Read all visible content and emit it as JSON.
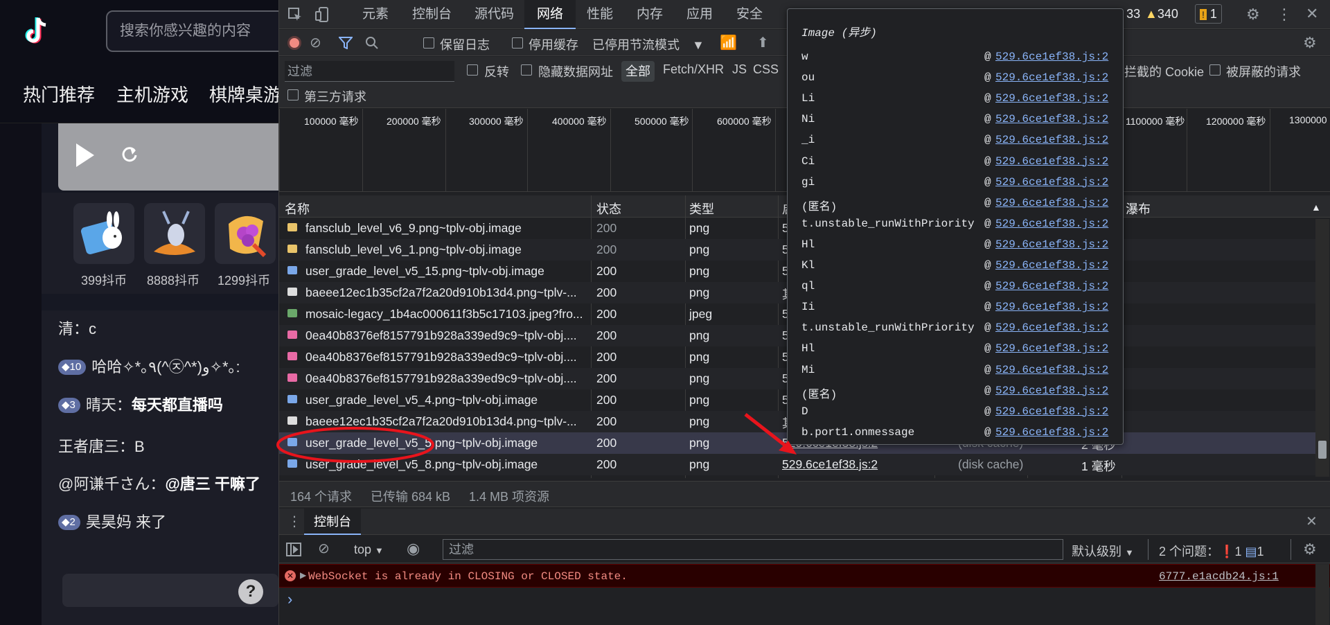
{
  "page": {
    "search_placeholder": "搜索你感兴趣的内容",
    "nav": [
      "热门推荐",
      "主机游戏",
      "棋牌桌游"
    ],
    "gifts": [
      {
        "price": "399抖币"
      },
      {
        "price": "8888抖币"
      },
      {
        "price": "1299抖币"
      }
    ],
    "chat": [
      {
        "badge": "",
        "user": "清：",
        "text": "c",
        "bold": false
      },
      {
        "badge": "10",
        "user": "",
        "text": "哈哈✧*｡٩(^㉨^*)و✧*｡:",
        "bold": false
      },
      {
        "badge": "3",
        "user": "晴天：",
        "text": "每天都直播吗",
        "bold": true
      },
      {
        "badge": "",
        "user": "王者唐三：",
        "text": "B",
        "bold": false
      },
      {
        "badge": "",
        "user": "@阿谦千さん：",
        "text": "@唐三 干嘛了",
        "bold": true
      },
      {
        "badge": "2",
        "user": "",
        "text": "昊昊妈 来了",
        "bold": false
      }
    ],
    "help": "?"
  },
  "devtools": {
    "tabs": [
      "元素",
      "控制台",
      "源代码",
      "网络",
      "性能",
      "内存",
      "应用",
      "安全"
    ],
    "active_tab": "网络",
    "error_count": "33",
    "warning_count": "340",
    "issue_count": "1",
    "toolbar": {
      "preserve_log": "保留日志",
      "disable_cache": "停用缓存",
      "throttle": "已停用节流模式"
    },
    "filter": {
      "placeholder": "过滤",
      "invert": "反转",
      "hide_data_urls": "隐藏数据网址",
      "all": "全部",
      "types": [
        "Fetch/XHR",
        "JS",
        "CSS"
      ],
      "blocked_cookies": "拦截的 Cookie",
      "blocked_requests": "被屏蔽的请求",
      "third_party": "第三方请求"
    },
    "timeline_ticks": [
      "100000 毫秒",
      "200000 毫秒",
      "300000 毫秒",
      "400000 毫秒",
      "500000 毫秒",
      "600000 毫秒",
      "1100000 毫秒",
      "1200000 毫秒",
      "1300000"
    ],
    "columns": {
      "name": "名称",
      "status": "状态",
      "type": "类型",
      "initiator": "启",
      "waterfall": "瀑布"
    },
    "rows": [
      {
        "name": "fansclub_level_v6_9.png~tplv-obj.image",
        "status": "200",
        "type": "png",
        "initiator": "5",
        "icon": "#e9c46a"
      },
      {
        "name": "fansclub_level_v6_1.png~tplv-obj.image",
        "status": "200",
        "type": "png",
        "initiator": "5",
        "icon": "#e9c46a"
      },
      {
        "name": "user_grade_level_v5_15.png~tplv-obj.image",
        "status": "200",
        "type": "png",
        "initiator": "5",
        "icon": "#7aa7e8"
      },
      {
        "name": "baeee12ec1b35cf2a7f2a20d910b13d4.png~tplv-...",
        "status": "200",
        "type": "png",
        "initiator": "其",
        "icon": "#dddddd"
      },
      {
        "name": "mosaic-legacy_1b4ac000611f3b5c17103.jpeg?fro...",
        "status": "200",
        "type": "jpeg",
        "initiator": "5",
        "icon": "#6aa86a"
      },
      {
        "name": "0ea40b8376ef8157791b928a339ed9c9~tplv-obj....",
        "status": "200",
        "type": "png",
        "initiator": "5",
        "icon": "#e86aa5"
      },
      {
        "name": "0ea40b8376ef8157791b928a339ed9c9~tplv-obj....",
        "status": "200",
        "type": "png",
        "initiator": "5",
        "icon": "#e86aa5"
      },
      {
        "name": "0ea40b8376ef8157791b928a339ed9c9~tplv-obj....",
        "status": "200",
        "type": "png",
        "initiator": "5",
        "icon": "#e86aa5"
      },
      {
        "name": "user_grade_level_v5_4.png~tplv-obj.image",
        "status": "200",
        "type": "png",
        "initiator": "5",
        "icon": "#7aa7e8"
      },
      {
        "name": "baeee12ec1b35cf2a7f2a20d910b13d4.png~tplv-...",
        "status": "200",
        "type": "png",
        "initiator": "其",
        "icon": "#dddddd"
      },
      {
        "name": "user_grade_level_v5_5.png~tplv-obj.image",
        "status": "200",
        "type": "png",
        "initiator": "529.6ce1ef38.js:2",
        "size": "(disk cache)",
        "time": "2 毫秒",
        "icon": "#7aa7e8",
        "selected": true
      },
      {
        "name": "user_grade_level_v5_8.png~tplv-obj.image",
        "status": "200",
        "type": "png",
        "initiator": "529.6ce1ef38.js:2",
        "size": "(disk cache)",
        "time": "1 毫秒",
        "icon": "#7aa7e8"
      }
    ],
    "status_bar": [
      "164 个请求",
      "已传输 684 kB",
      "1.4 MB 项资源"
    ],
    "console": {
      "tab": "控制台",
      "context": "top",
      "filter_placeholder": "过滤",
      "level": "默认级别",
      "issues_label": "2 个问题：",
      "issue_warn": "1",
      "issue_info": "1",
      "error_message": "WebSocket is already in CLOSING or CLOSED state.",
      "error_source": "6777.e1acdb24.js:1",
      "prompt": "›"
    },
    "popover": {
      "title": "Image (异步)",
      "frames": [
        {
          "fn": "w",
          "src": "529.6ce1ef38.js:2"
        },
        {
          "fn": "ou",
          "src": "529.6ce1ef38.js:2"
        },
        {
          "fn": "Li",
          "src": "529.6ce1ef38.js:2"
        },
        {
          "fn": "Ni",
          "src": "529.6ce1ef38.js:2"
        },
        {
          "fn": "_i",
          "src": "529.6ce1ef38.js:2"
        },
        {
          "fn": "Ci",
          "src": "529.6ce1ef38.js:2"
        },
        {
          "fn": "gi",
          "src": "529.6ce1ef38.js:2"
        },
        {
          "fn": "(匿名)",
          "src": "529.6ce1ef38.js:2"
        },
        {
          "fn": "t.unstable_runWithPriority",
          "src": "529.6ce1ef38.js:2"
        },
        {
          "fn": "Hl",
          "src": "529.6ce1ef38.js:2"
        },
        {
          "fn": "Kl",
          "src": "529.6ce1ef38.js:2"
        },
        {
          "fn": "ql",
          "src": "529.6ce1ef38.js:2"
        },
        {
          "fn": "Ii",
          "src": "529.6ce1ef38.js:2"
        },
        {
          "fn": "t.unstable_runWithPriority",
          "src": "529.6ce1ef38.js:2"
        },
        {
          "fn": "Hl",
          "src": "529.6ce1ef38.js:2"
        },
        {
          "fn": "Mi",
          "src": "529.6ce1ef38.js:2"
        },
        {
          "fn": "(匿名)",
          "src": "529.6ce1ef38.js:2"
        },
        {
          "fn": "D",
          "src": "529.6ce1ef38.js:2"
        },
        {
          "fn": "b.port1.onmessage",
          "src": "529.6ce1ef38.js:2"
        }
      ]
    }
  }
}
